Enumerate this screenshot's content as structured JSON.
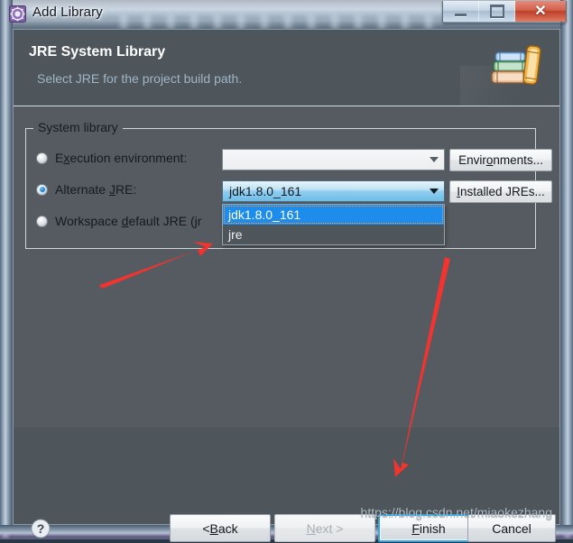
{
  "window": {
    "title": "Add Library",
    "app_icon": "eclipse-library-gear-icon",
    "controls": {
      "minimize": "minimize-icon",
      "maximize": "maximize-icon",
      "close": "✕"
    }
  },
  "banner": {
    "title": "JRE System Library",
    "subtitle": "Select JRE for the project build path.",
    "icon": "books-stack-icon"
  },
  "group": {
    "legend": "System library",
    "options": [
      {
        "id": "execution-environment",
        "label_before": "E",
        "label_mnemonic": "x",
        "label_after": "ecution environment:",
        "selected": false
      },
      {
        "id": "alternate-jre",
        "label_before": "Alternate ",
        "label_mnemonic": "J",
        "label_after": "RE:",
        "selected": true
      },
      {
        "id": "workspace-default-jre",
        "label_before": "Workspace ",
        "label_mnemonic": "d",
        "label_after": "efault JRE (jr",
        "selected": false
      }
    ],
    "combo_environment": {
      "value": "",
      "placeholder": ""
    },
    "combo_jre": {
      "value": "jdk1.8.0_161",
      "expanded": true,
      "items": [
        {
          "label": "jdk1.8.0_161",
          "selected": true
        },
        {
          "label": "jre",
          "selected": false
        }
      ]
    },
    "buttons": [
      {
        "id": "environments",
        "before": "Envir",
        "mnemonic": "o",
        "after": "nments..."
      },
      {
        "id": "installed-jres",
        "before": "",
        "mnemonic": "I",
        "after": "nstalled JREs..."
      }
    ]
  },
  "footer": {
    "help_icon": "help-question-icon",
    "buttons": [
      {
        "id": "back",
        "before": "< ",
        "mnemonic": "B",
        "after": "ack",
        "disabled": false,
        "default": false
      },
      {
        "id": "next",
        "before": "",
        "mnemonic": "N",
        "after": "ext >",
        "disabled": true,
        "default": false
      },
      {
        "id": "finish",
        "before": "",
        "mnemonic": "F",
        "after": "inish",
        "disabled": false,
        "default": true
      },
      {
        "id": "cancel",
        "before": "Cancel",
        "mnemonic": "",
        "after": "",
        "disabled": false,
        "default": false
      }
    ],
    "watermark": "https://blog.csdn.net/miaokezhang"
  },
  "annotations": {
    "arrow_color": "#f5332e",
    "arrows": [
      {
        "id": "arrow-to-jre-item",
        "from": [
          110,
          314
        ],
        "to": [
          236,
          272
        ]
      },
      {
        "id": "arrow-to-finish",
        "from": [
          492,
          286
        ],
        "to": [
          438,
          524
        ]
      }
    ]
  }
}
